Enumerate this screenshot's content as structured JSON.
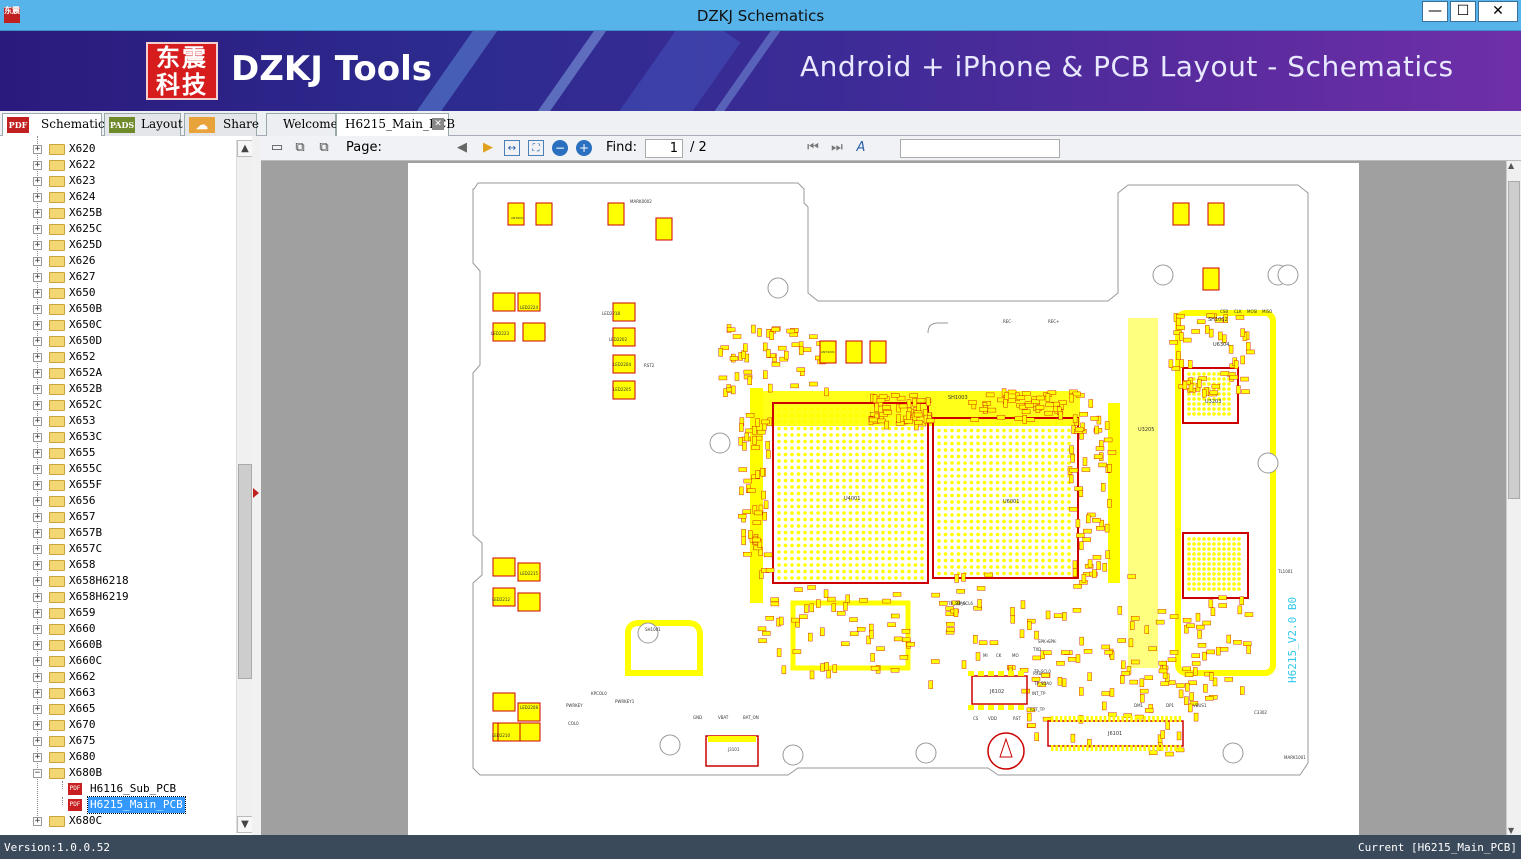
{
  "window": {
    "title": "DZKJ Schematics",
    "app_icon_text": "东震",
    "minimize": "—",
    "maximize": "☐",
    "close": "✕"
  },
  "banner": {
    "logo_text": "东震科技",
    "brand": "DZKJ Tools",
    "tagline": "Android + iPhone & PCB Layout - Schematics"
  },
  "left_tabs": [
    {
      "icon": "PDF",
      "label": "Schematic"
    },
    {
      "icon": "PADS",
      "label": "Layout"
    },
    {
      "icon": "☁",
      "label": "Share"
    }
  ],
  "doc_tabs": [
    {
      "label": "Welcome"
    },
    {
      "label": "H6215_Main_PCB"
    }
  ],
  "tree": {
    "folders": [
      "X620",
      "X622",
      "X623",
      "X624",
      "X625B",
      "X625C",
      "X625D",
      "X626",
      "X627",
      "X650",
      "X650B",
      "X650C",
      "X650D",
      "X652",
      "X652A",
      "X652B",
      "X652C",
      "X653",
      "X653C",
      "X655",
      "X655C",
      "X655F",
      "X656",
      "X657",
      "X657B",
      "X657C",
      "X658",
      "X658H6218",
      "X658H6219",
      "X659",
      "X660",
      "X660B",
      "X660C",
      "X662",
      "X663",
      "X665",
      "X670",
      "X675",
      "X680",
      "X680B"
    ],
    "children": [
      "H6116_Sub_PCB",
      "H6215_Main_PCB"
    ],
    "after": "X680C"
  },
  "toolbar": {
    "page_label": "Page:",
    "page_current": "1",
    "page_total": "/ 2",
    "find_label": "Find:",
    "find_value": ""
  },
  "pcb": {
    "board_label": "H6215_V2.0 B0",
    "labels": [
      "U4001",
      "U6001",
      "SH1003",
      "SH1002",
      "U3203",
      "U3205",
      "U6304",
      "J6101",
      "J6102",
      "J3101",
      "LED2224",
      "LED2223",
      "LED2218",
      "LED2202",
      "LED2204",
      "LED2205",
      "LED2215",
      "LED2212",
      "LED2208",
      "LED2210",
      "ANT4001",
      "ANT6001",
      "PWRKEY",
      "PWRKEY1",
      "SH1001",
      "MARK0002",
      "MARK1001",
      "REC-",
      "REC+",
      "TP_SDA6",
      "TP_SCL6",
      "RST2",
      "KPCOL0",
      "COL0",
      "GND",
      "VBAT",
      "BAT_ON",
      "VDD",
      "RST",
      "CS",
      "MI",
      "CK",
      "MO",
      "TXD",
      "RXD",
      "INT_TP",
      "RST_TP",
      "CSB",
      "CLK",
      "MOSI",
      "MISO",
      "TL1001",
      "SPK+",
      "SPK-",
      "DP1",
      "DM1",
      "VBUS1",
      "C3302",
      "TP_SCL0",
      "TP_SDA0"
    ]
  },
  "status": {
    "version": "Version:1.0.0.52",
    "current": "Current [H6215_Main_PCB]"
  },
  "colors": {
    "title_bg": "#57b4ea",
    "banner_bg": "#3a2a95",
    "pad_yellow": "#ffff00",
    "outline_red": "#cc0000",
    "selection": "#3399ff"
  }
}
